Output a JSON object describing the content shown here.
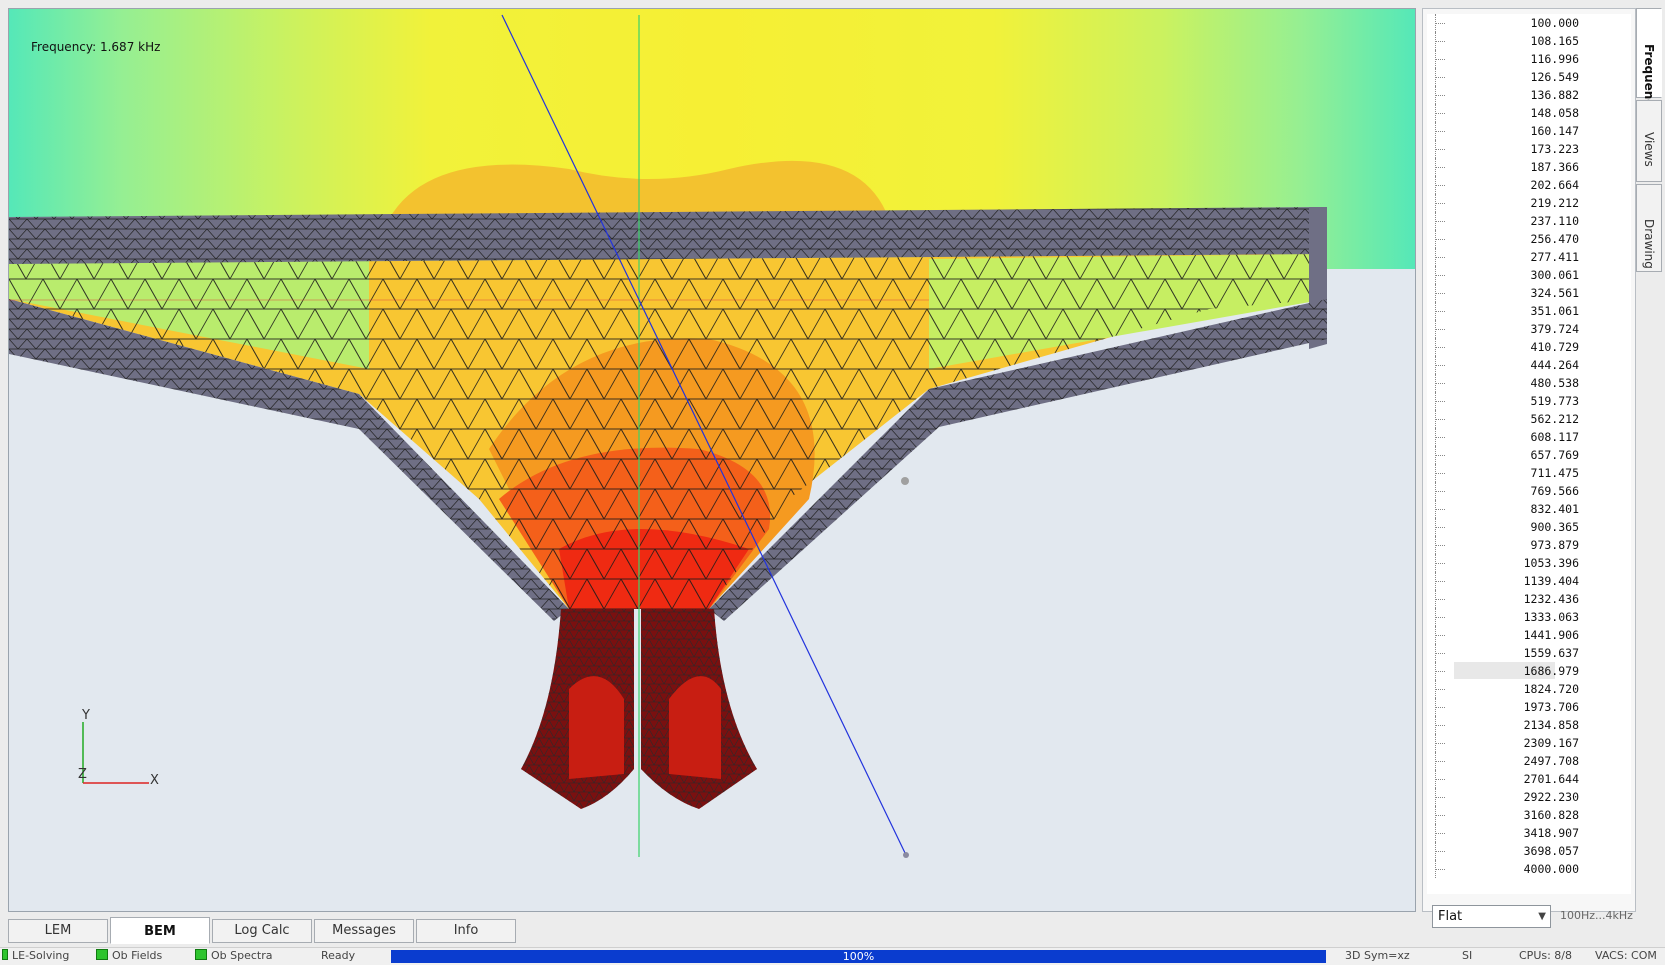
{
  "viewport": {
    "frequency_label": "Frequency: 1.687 kHz",
    "axis": {
      "y": "Y",
      "x": "X",
      "z": "Z"
    }
  },
  "frequencies": {
    "items": [
      "100.000",
      "108.165",
      "116.996",
      "126.549",
      "136.882",
      "148.058",
      "160.147",
      "173.223",
      "187.366",
      "202.664",
      "219.212",
      "237.110",
      "256.470",
      "277.411",
      "300.061",
      "324.561",
      "351.061",
      "379.724",
      "410.729",
      "444.264",
      "480.538",
      "519.773",
      "562.212",
      "608.117",
      "657.769",
      "711.475",
      "769.566",
      "832.401",
      "900.365",
      "973.879",
      "1053.396",
      "1139.404",
      "1232.436",
      "1333.063",
      "1441.906",
      "1559.637",
      "1686.979",
      "1824.720",
      "1973.706",
      "2134.858",
      "2309.167",
      "2497.708",
      "2701.644",
      "2922.230",
      "3160.828",
      "3418.907",
      "3698.057",
      "4000.000"
    ],
    "selected": "1686.979"
  },
  "side_tabs": [
    "Frequencies",
    "Views",
    "Drawing"
  ],
  "bottom_tabs": [
    "LEM",
    "BEM",
    "Log Calc",
    "Messages",
    "Info"
  ],
  "active_bottom_tab": "BEM",
  "weighting": {
    "value": "Flat"
  },
  "range_label": "100Hz...4kHz",
  "status": {
    "le_solving": "LE-Solving",
    "ob_fields": "Ob Fields",
    "ob_spectra": "Ob Spectra",
    "state": "Ready",
    "progress": "100%",
    "symmetry": "3D Sym=xz",
    "units": "SI",
    "cpus": "CPUs: 8/8",
    "vacs": "VACS: COM"
  },
  "colors": {
    "progress_fill": "#0a3ccf",
    "led_on": "#2ec42e"
  }
}
